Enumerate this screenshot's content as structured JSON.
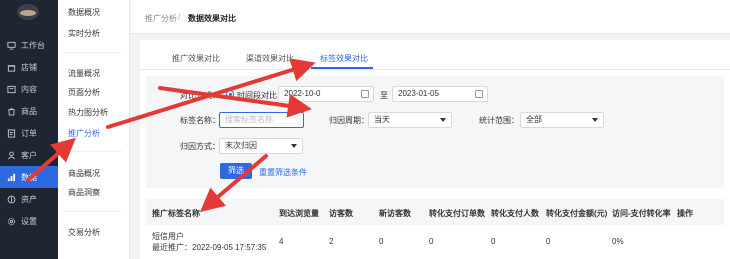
{
  "sidebar": {
    "items": [
      {
        "label": "工作台",
        "icon": "desktop-icon"
      },
      {
        "label": "店铺",
        "icon": "shop-icon"
      },
      {
        "label": "内容",
        "icon": "content-icon"
      },
      {
        "label": "商品",
        "icon": "goods-icon"
      },
      {
        "label": "订单",
        "icon": "order-icon"
      },
      {
        "label": "客户",
        "icon": "customer-icon"
      },
      {
        "label": "数据",
        "icon": "data-chart-icon"
      },
      {
        "label": "资产",
        "icon": "asset-icon"
      },
      {
        "label": "设置",
        "icon": "gear-icon"
      }
    ]
  },
  "subnav": {
    "items": [
      "数据概况",
      "实时分析",
      "流量概况",
      "页面分析",
      "热力图分析",
      "推广分析",
      "商品概况",
      "商品洞察",
      "交易分析"
    ]
  },
  "breadcrumb": {
    "parent": "推广分析",
    "separator": "/",
    "current": "数据效果对比"
  },
  "tabs": [
    "推广效果对比",
    "渠道效果对比",
    "标签效果对比"
  ],
  "filters": {
    "compare_label": "对比方式：",
    "compare_option": "时间段对比",
    "date_start": "2022-10-0",
    "date_to": "至",
    "date_end": "2023-01-05",
    "tag_label": "标签名称：",
    "tag_placeholder": "搜索标签名称",
    "period_label": "归因周期：",
    "period_value": "当天",
    "stat_label": "统计范围：",
    "stat_value": "全部",
    "method_label": "归因方式：",
    "method_value": "末次归因",
    "filter_button": "筛选",
    "reset_link": "重置筛选条件"
  },
  "table": {
    "headers": [
      "推广标签名称",
      "到达浏览量",
      "访客数",
      "新访客数",
      "转化支付订单数",
      "转化支付人数",
      "转化支付金额(元)",
      "访问-支付转化率",
      "操作"
    ],
    "rows": [
      {
        "name": "短信用户",
        "subtitle": "最近推广：2022-09-05 17:57:35",
        "values": [
          "4",
          "2",
          "0",
          "0",
          "0",
          "0",
          "0%",
          ""
        ]
      }
    ]
  },
  "colors": {
    "accent": "#2d6ae0",
    "sidebar_bg": "#1f2533",
    "arrow": "#e53935"
  }
}
